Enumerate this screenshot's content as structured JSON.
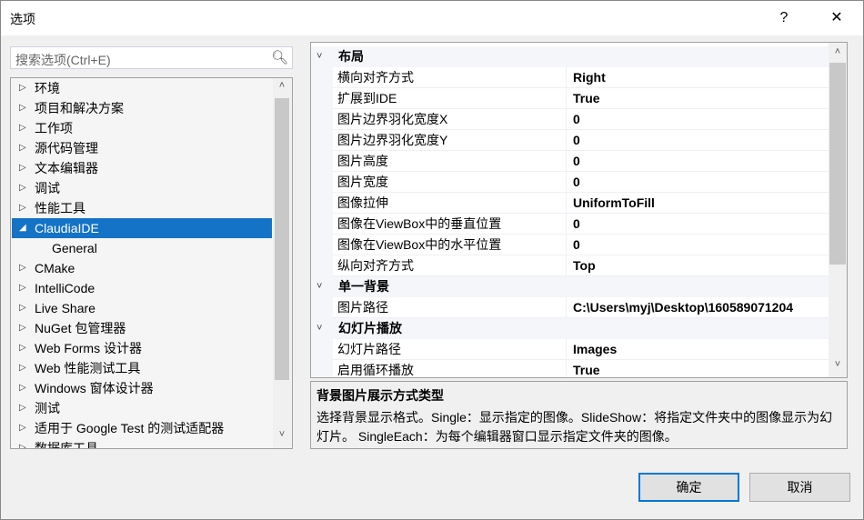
{
  "window": {
    "title": "选项",
    "help_label": "?",
    "close_label": "✕"
  },
  "search": {
    "placeholder": "搜索选项(Ctrl+E)",
    "icon": "search-icon"
  },
  "tree": {
    "items": [
      {
        "label": "环境",
        "expanded": false
      },
      {
        "label": "项目和解决方案",
        "expanded": false
      },
      {
        "label": "工作项",
        "expanded": false
      },
      {
        "label": "源代码管理",
        "expanded": false
      },
      {
        "label": "文本编辑器",
        "expanded": false
      },
      {
        "label": "调试",
        "expanded": false
      },
      {
        "label": "性能工具",
        "expanded": false
      },
      {
        "label": "ClaudiaIDE",
        "expanded": true,
        "selected": true
      },
      {
        "label": "General",
        "child": true
      },
      {
        "label": "CMake",
        "expanded": false
      },
      {
        "label": "IntelliCode",
        "expanded": false
      },
      {
        "label": "Live Share",
        "expanded": false
      },
      {
        "label": "NuGet 包管理器",
        "expanded": false
      },
      {
        "label": "Web Forms 设计器",
        "expanded": false
      },
      {
        "label": "Web 性能测试工具",
        "expanded": false
      },
      {
        "label": "Windows 窗体设计器",
        "expanded": false
      },
      {
        "label": "测试",
        "expanded": false
      },
      {
        "label": "适用于 Google Test 的测试适配器",
        "expanded": false
      },
      {
        "label": "数据库工具",
        "expanded": false
      }
    ]
  },
  "properties": {
    "rows": [
      {
        "type": "category",
        "label": "布局"
      },
      {
        "type": "item",
        "name": "横向对齐方式",
        "value": "Right"
      },
      {
        "type": "item",
        "name": "扩展到IDE",
        "value": "True"
      },
      {
        "type": "item",
        "name": "图片边界羽化宽度X",
        "value": "0"
      },
      {
        "type": "item",
        "name": "图片边界羽化宽度Y",
        "value": "0"
      },
      {
        "type": "item",
        "name": "图片高度",
        "value": "0"
      },
      {
        "type": "item",
        "name": "图片宽度",
        "value": "0"
      },
      {
        "type": "item",
        "name": "图像拉伸",
        "value": "UniformToFill"
      },
      {
        "type": "item",
        "name": "图像在ViewBox中的垂直位置",
        "value": "0"
      },
      {
        "type": "item",
        "name": "图像在ViewBox中的水平位置",
        "value": "0"
      },
      {
        "type": "item",
        "name": "纵向对齐方式",
        "value": "Top"
      },
      {
        "type": "category",
        "label": "单一背景"
      },
      {
        "type": "item",
        "name": "图片路径",
        "value": "C:\\Users\\myj\\Desktop\\160589071204"
      },
      {
        "type": "category",
        "label": "幻灯片播放"
      },
      {
        "type": "item",
        "name": "幻灯片路径",
        "value": "Images"
      },
      {
        "type": "item",
        "name": "启用循环播放",
        "value": "True"
      }
    ]
  },
  "description": {
    "title": "背景图片展示方式类型",
    "text": "选择背景显示格式。Single：显示指定的图像。SlideShow：将指定文件夹中的图像显示为幻灯片。 SingleEach：为每个编辑器窗口显示指定文件夹的图像。"
  },
  "buttons": {
    "ok": "确定",
    "cancel": "取消"
  },
  "colors": {
    "selection": "#1473c6",
    "primary_border": "#0078d7"
  }
}
